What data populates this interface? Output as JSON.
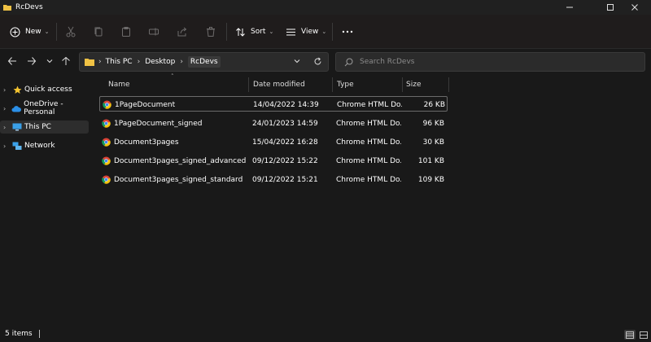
{
  "window": {
    "title": "RcDevs"
  },
  "toolbar": {
    "new_label": "New",
    "sort_label": "Sort",
    "view_label": "View"
  },
  "address": {
    "crumbs": [
      "This PC",
      "Desktop",
      "RcDevs"
    ]
  },
  "search": {
    "placeholder": "Search RcDevs"
  },
  "sidebar": {
    "items": [
      {
        "label": "Quick access"
      },
      {
        "label": "OneDrive - Personal"
      },
      {
        "label": "This PC"
      },
      {
        "label": "Network"
      }
    ]
  },
  "columns": {
    "name": "Name",
    "date": "Date modified",
    "type": "Type",
    "size": "Size"
  },
  "files": [
    {
      "name": "1PageDocument",
      "date": "14/04/2022 14:39",
      "type": "Chrome HTML Do...",
      "size": "26 KB"
    },
    {
      "name": "1PageDocument_signed",
      "date": "24/01/2023 14:59",
      "type": "Chrome HTML Do...",
      "size": "96 KB"
    },
    {
      "name": "Document3pages",
      "date": "15/04/2022 16:28",
      "type": "Chrome HTML Do...",
      "size": "30 KB"
    },
    {
      "name": "Document3pages_signed_advanced",
      "date": "09/12/2022 15:22",
      "type": "Chrome HTML Do...",
      "size": "101 KB"
    },
    {
      "name": "Document3pages_signed_standard",
      "date": "09/12/2022 15:21",
      "type": "Chrome HTML Do...",
      "size": "109 KB"
    }
  ],
  "status": {
    "items_count": "5 items"
  }
}
